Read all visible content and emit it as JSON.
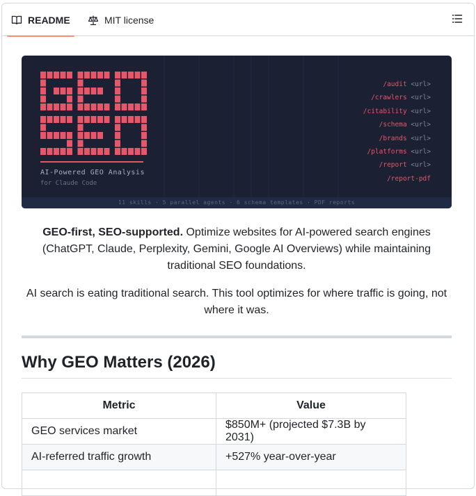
{
  "tabs": {
    "readme": "README",
    "license": "MIT license"
  },
  "banner": {
    "logo_lines": [
      "GEO",
      "SEO"
    ],
    "subtitle": "AI-Powered GEO Analysis",
    "tagline": "for Claude Code",
    "commands": [
      {
        "cmd": "/audit",
        "arg": "<url>"
      },
      {
        "cmd": "/crawlers",
        "arg": "<url>"
      },
      {
        "cmd": "/citability",
        "arg": "<url>"
      },
      {
        "cmd": "/schema",
        "arg": "<url>"
      },
      {
        "cmd": "/brands",
        "arg": "<url>"
      },
      {
        "cmd": "/platforms",
        "arg": "<url>"
      },
      {
        "cmd": "/report",
        "arg": "<url>"
      },
      {
        "cmd": "/report-pdf",
        "arg": ""
      }
    ],
    "footer": "11 skills · 5 parallel agents · 6 schema templates · PDF reports",
    "colors": {
      "background": "#1b2032",
      "accent": "#e8566a"
    }
  },
  "intro": {
    "bold": "GEO-first, SEO-supported.",
    "rest": " Optimize websites for AI-powered search engines (ChatGPT, Claude, Perplexity, Gemini, Google AI Overviews) while maintaining traditional SEO foundations."
  },
  "tagline_para": "AI search is eating traditional search. This tool optimizes for where traffic is going, not where it was.",
  "section": {
    "heading": "Why GEO Matters (2026)"
  },
  "table": {
    "headers": [
      "Metric",
      "Value"
    ],
    "rows": [
      [
        "GEO services market",
        "$850M+ (projected $7.3B by 2031)"
      ],
      [
        "AI-referred traffic growth",
        "+527% year-over-year"
      ]
    ]
  },
  "icons": {
    "readme": "book-icon",
    "license": "scale-icon",
    "outline": "list-icon"
  }
}
